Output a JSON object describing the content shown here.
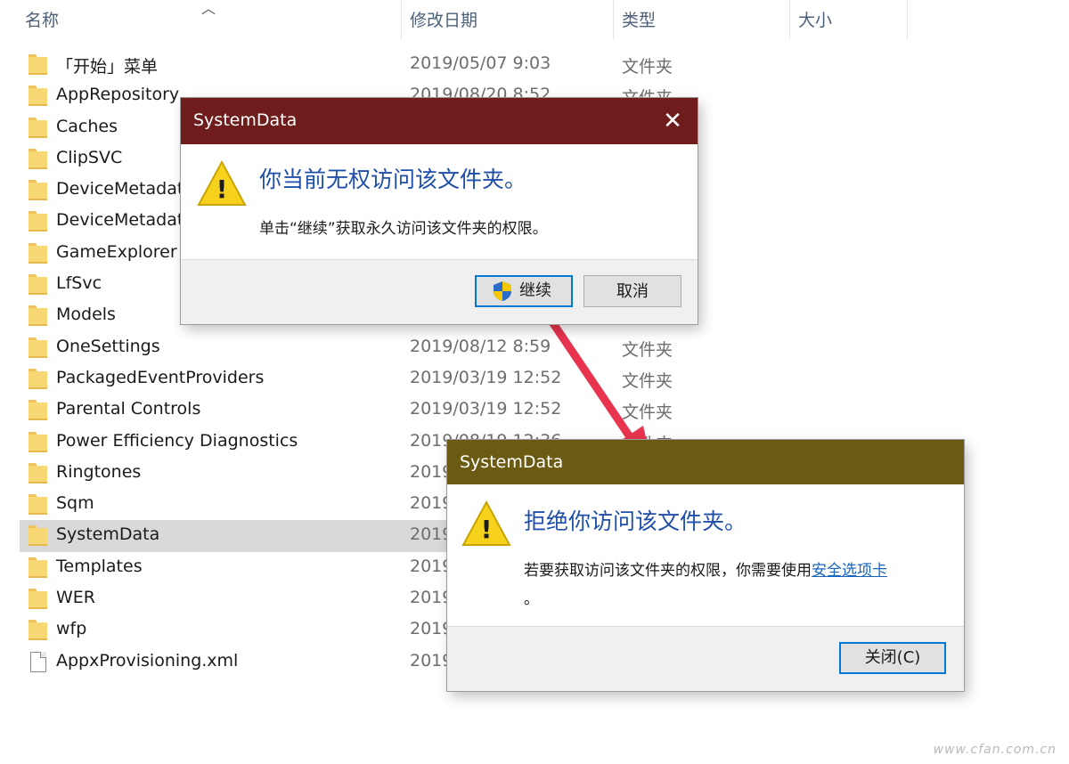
{
  "columns": {
    "name": "名称",
    "modified": "修改日期",
    "type": "类型",
    "size": "大小"
  },
  "rows": [
    {
      "kind": "folder",
      "name": "「开始」菜单",
      "date": "2019/05/07 9:03",
      "type": "文件夹"
    },
    {
      "kind": "folder",
      "name": "AppRepository",
      "date": "2019/08/20 8:52",
      "type": "文件夹"
    },
    {
      "kind": "folder",
      "name": "Caches",
      "date": "",
      "type": ""
    },
    {
      "kind": "folder",
      "name": "ClipSVC",
      "date": "",
      "type": ""
    },
    {
      "kind": "folder",
      "name": "DeviceMetadat",
      "date": "",
      "type": ""
    },
    {
      "kind": "folder",
      "name": "DeviceMetadat",
      "date": "",
      "type": ""
    },
    {
      "kind": "folder",
      "name": "GameExplorer",
      "date": "",
      "type": ""
    },
    {
      "kind": "folder",
      "name": "LfSvc",
      "date": "",
      "type": ""
    },
    {
      "kind": "folder",
      "name": "Models",
      "date": "",
      "type": ""
    },
    {
      "kind": "folder",
      "name": "OneSettings",
      "date": "2019/08/12 8:59",
      "type": "文件夹"
    },
    {
      "kind": "folder",
      "name": "PackagedEventProviders",
      "date": "2019/03/19 12:52",
      "type": "文件夹"
    },
    {
      "kind": "folder",
      "name": "Parental Controls",
      "date": "2019/03/19 12:52",
      "type": "文件夹"
    },
    {
      "kind": "folder",
      "name": "Power Efficiency Diagnostics",
      "date": "2019/08/19 12:36",
      "type": "文件夹"
    },
    {
      "kind": "folder",
      "name": "Ringtones",
      "date": "2019",
      "type": ""
    },
    {
      "kind": "folder",
      "name": "Sqm",
      "date": "2019",
      "type": ""
    },
    {
      "kind": "folder",
      "name": "SystemData",
      "date": "2019",
      "type": "",
      "selected": true
    },
    {
      "kind": "folder",
      "name": "Templates",
      "date": "2019",
      "type": ""
    },
    {
      "kind": "folder",
      "name": "WER",
      "date": "2019",
      "type": ""
    },
    {
      "kind": "folder",
      "name": "wfp",
      "date": "2019",
      "type": ""
    },
    {
      "kind": "file",
      "name": "AppxProvisioning.xml",
      "date": "2019",
      "type": ""
    }
  ],
  "dialog1": {
    "title": "SystemData",
    "close_glyph": "✕",
    "message": "你当前无权访问该文件夹。",
    "detail": "单击“继续”获取永久访问该文件夹的权限。",
    "continue_label": "继续",
    "cancel_label": "取消",
    "title_color": "#6e1c1c"
  },
  "dialog2": {
    "title": "SystemData",
    "message": "拒绝你访问该文件夹。",
    "detail_prefix": "若要获取访问该文件夹的权限，你需要使用",
    "detail_link": "安全选项卡",
    "detail_suffix": "。",
    "close_label": "关闭(C)",
    "title_color": "#6b5a12"
  },
  "arrow_color": "#e8344e",
  "watermark": "www.cfan.com.cn"
}
